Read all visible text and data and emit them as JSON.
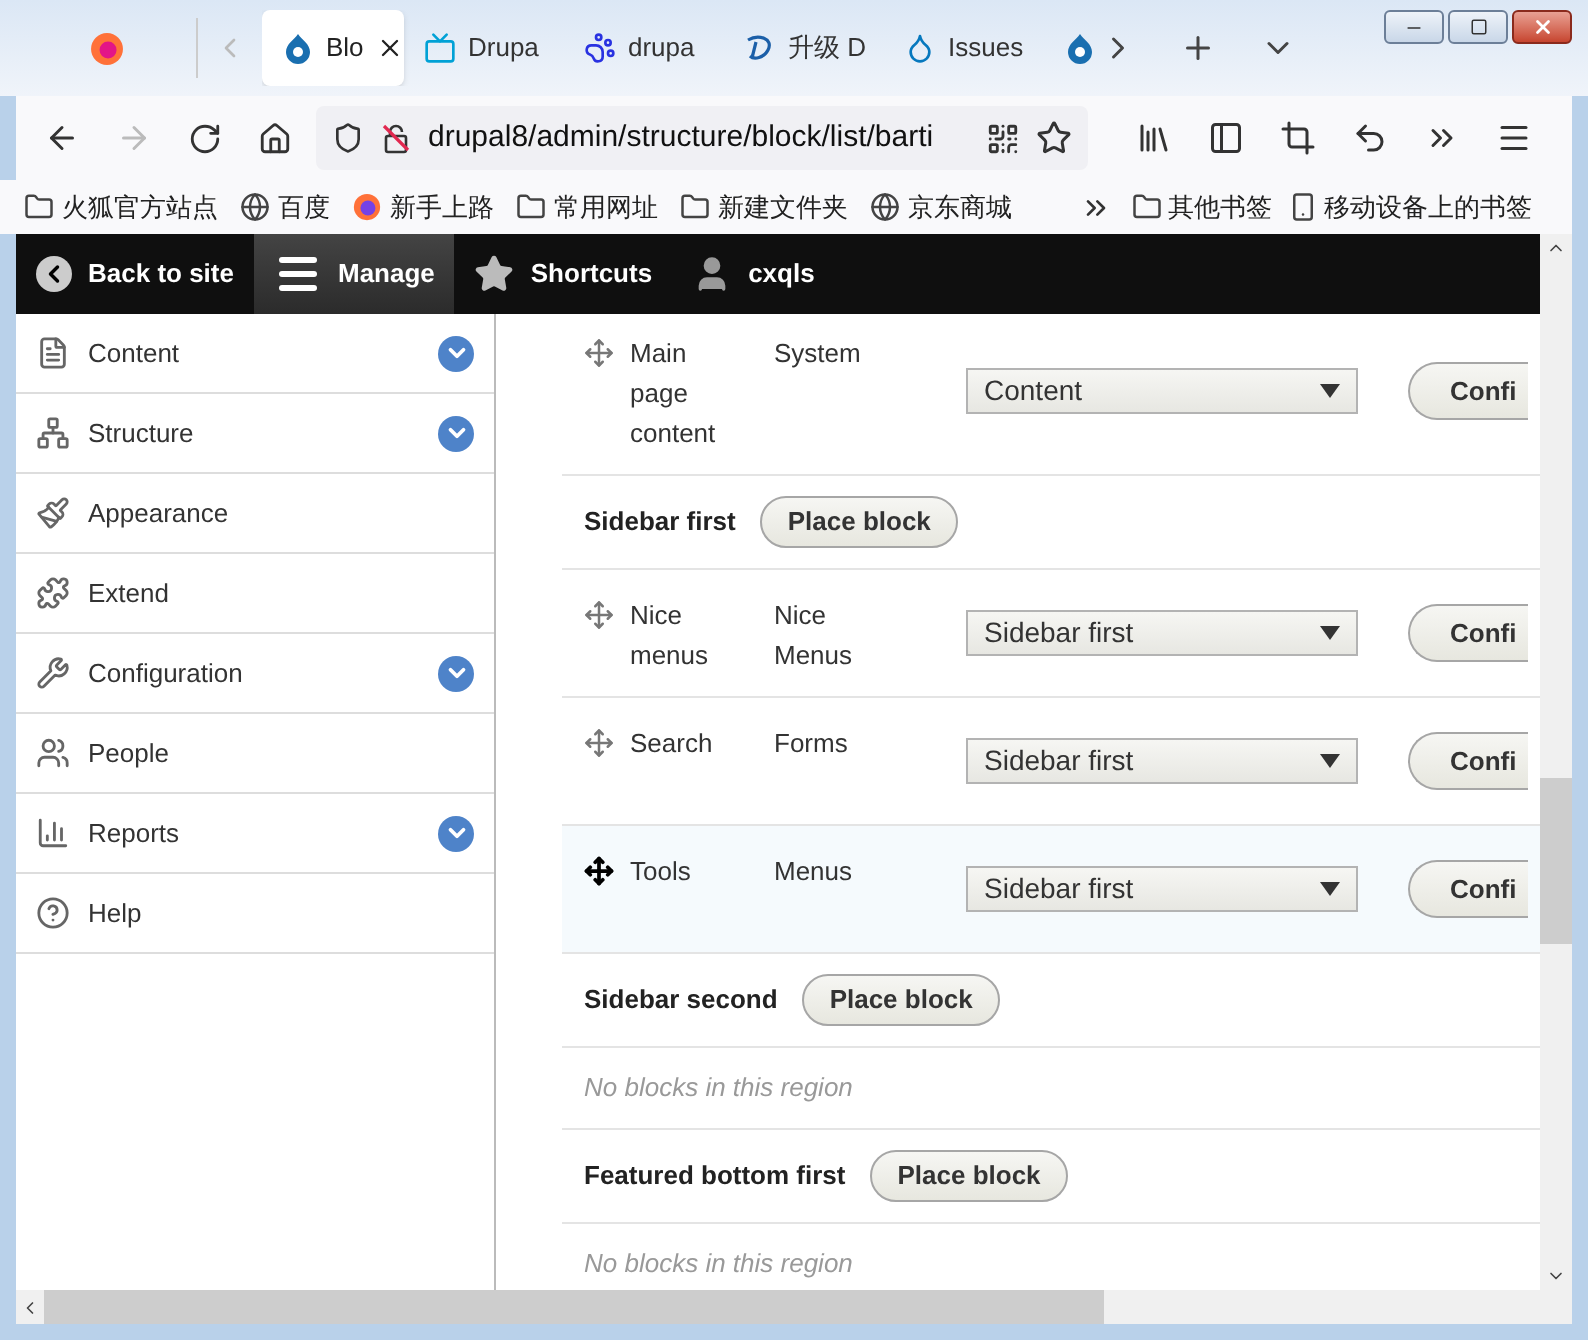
{
  "browser": {
    "tabs": [
      {
        "label": "Blo",
        "selected": true
      },
      {
        "label": "Drupa",
        "selected": false
      },
      {
        "label": "drupa",
        "selected": false
      },
      {
        "label": "升级 D",
        "selected": false
      },
      {
        "label": "Issues",
        "selected": false
      },
      {
        "selected": false
      }
    ],
    "address": "drupal8/admin/structure/block/list/barti",
    "bookmarks": [
      {
        "label": "火狐官方站点",
        "kind": "folder"
      },
      {
        "label": "百度",
        "kind": "globe"
      },
      {
        "label": "新手上路",
        "kind": "firefox"
      },
      {
        "label": "常用网址",
        "kind": "folder"
      },
      {
        "label": "新建文件夹",
        "kind": "folder"
      },
      {
        "label": "京东商城",
        "kind": "globe"
      }
    ],
    "other_bookmarks": [
      {
        "label": "其他书签",
        "kind": "folder"
      },
      {
        "label": "移动设备上的书签",
        "kind": "phone"
      }
    ]
  },
  "toolbar": [
    {
      "label": "Back to site",
      "kind": "back",
      "selected": false
    },
    {
      "label": "Manage",
      "kind": "menu",
      "selected": true
    },
    {
      "label": "Shortcuts",
      "kind": "star",
      "selected": false
    },
    {
      "label": "cxqls",
      "kind": "user",
      "selected": false
    }
  ],
  "sidebar": {
    "items": [
      {
        "label": "Content",
        "kind": "file",
        "expandable": true
      },
      {
        "label": "Structure",
        "kind": "structure",
        "expandable": true
      },
      {
        "label": "Appearance",
        "kind": "brush",
        "expandable": false
      },
      {
        "label": "Extend",
        "kind": "puzzle",
        "expandable": false
      },
      {
        "label": "Configuration",
        "kind": "wrench",
        "expandable": true
      },
      {
        "label": "People",
        "kind": "people",
        "expandable": false
      },
      {
        "label": "Reports",
        "kind": "reports",
        "expandable": true
      },
      {
        "label": "Help",
        "kind": "help",
        "expandable": false
      }
    ]
  },
  "rows": [
    {
      "kind": "block",
      "title": "Main page content",
      "category": "System",
      "region": "Content",
      "button": "Confi",
      "highlighted": false
    },
    {
      "kind": "region",
      "title": "Sidebar first",
      "button": "Place block"
    },
    {
      "kind": "block",
      "title": "Nice menus",
      "category": "Nice Menus",
      "region": "Sidebar first",
      "button": "Confi",
      "highlighted": false
    },
    {
      "kind": "block",
      "title": "Search",
      "category": "Forms",
      "region": "Sidebar first",
      "button": "Confi",
      "highlighted": false
    },
    {
      "kind": "block",
      "title": "Tools",
      "category": "Menus",
      "region": "Sidebar first",
      "button": "Confi",
      "highlighted": true
    },
    {
      "kind": "region",
      "title": "Sidebar second",
      "button": "Place block"
    },
    {
      "kind": "empty",
      "text": "No blocks in this region"
    },
    {
      "kind": "region",
      "title": "Featured bottom first",
      "button": "Place block"
    },
    {
      "kind": "empty",
      "text": "No blocks in this region"
    }
  ]
}
